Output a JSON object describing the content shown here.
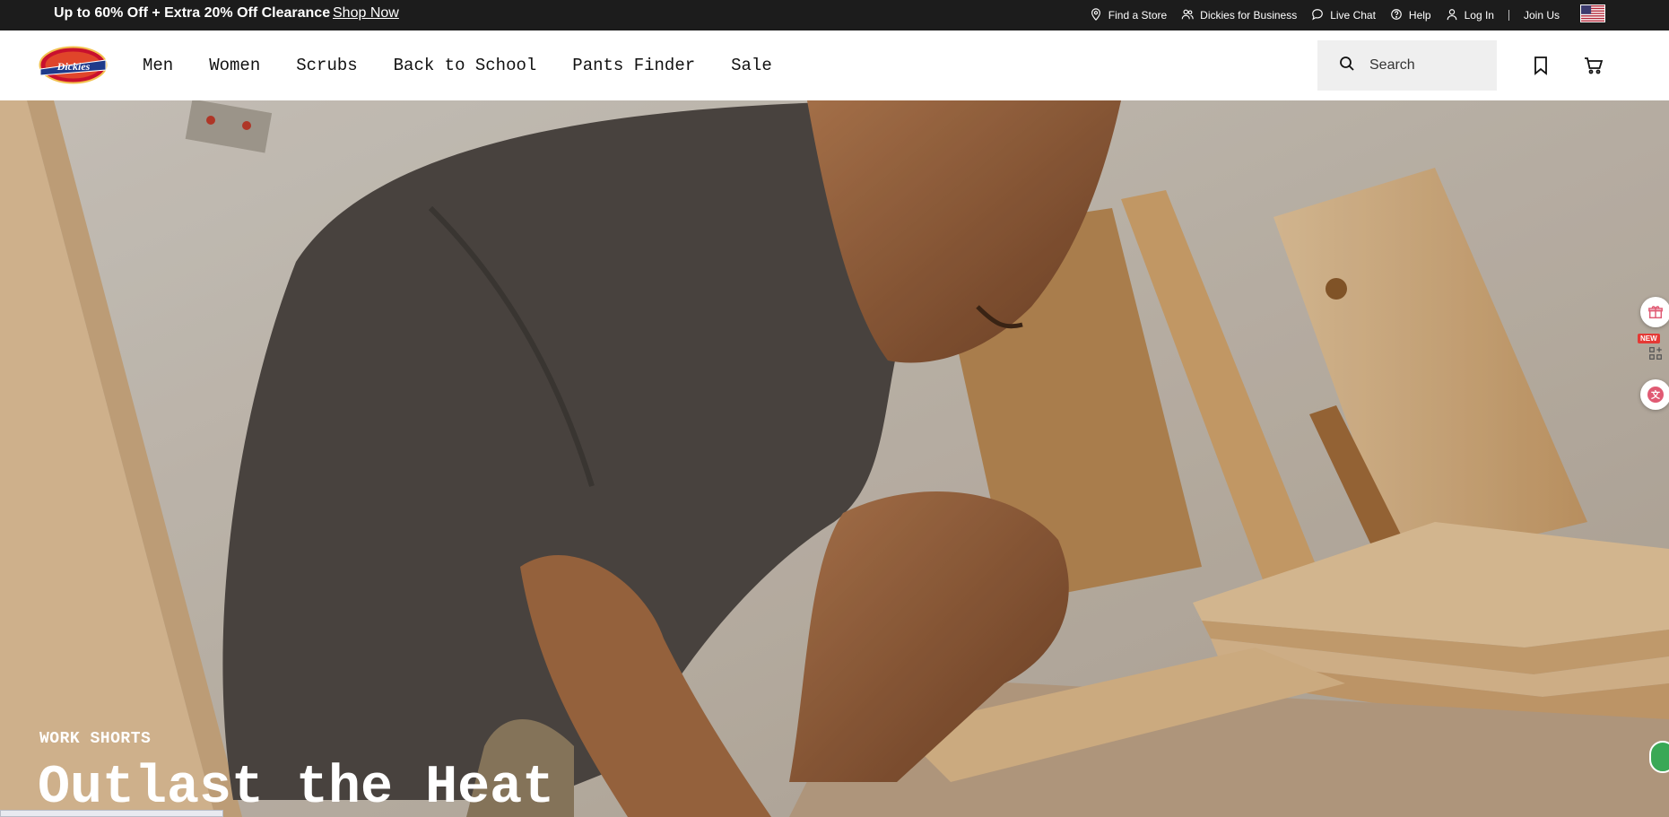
{
  "promo": {
    "text": "Up to 60% Off + Extra 20% Off Clearance",
    "link": "Shop Now"
  },
  "utility": {
    "find_store": "Find a Store",
    "business": "Dickies for Business",
    "live_chat": "Live Chat",
    "help": "Help",
    "login": "Log In",
    "join": "Join Us"
  },
  "brand": {
    "logo_text": "Dickies",
    "accent": "#c8102e",
    "navy": "#1f3a8a"
  },
  "nav": {
    "items": [
      {
        "label": "Men"
      },
      {
        "label": "Women"
      },
      {
        "label": "Scrubs"
      },
      {
        "label": "Back to School"
      },
      {
        "label": "Pants Finder"
      },
      {
        "label": "Sale"
      }
    ]
  },
  "search": {
    "placeholder": "Search"
  },
  "icons": {
    "wishlist": "bookmark-icon",
    "cart": "cart-icon",
    "search": "search-icon",
    "location": "map-pin-icon",
    "business": "users-icon",
    "chat": "chat-bubble-icon",
    "help": "help-circle-icon",
    "user": "user-icon"
  },
  "hero": {
    "eyebrow": "WORK SHORTS",
    "title": "Outlast the Heat"
  },
  "widgets": {
    "new_badge": "NEW"
  }
}
